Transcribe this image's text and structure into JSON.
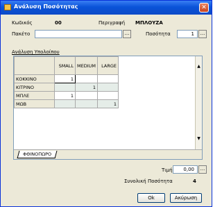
{
  "window": {
    "title": "Ανάλυση Ποσότητας",
    "close_glyph": "✕"
  },
  "form": {
    "code_label": "Κωδικός",
    "code_value": "00",
    "desc_label": "Περιγραφή",
    "desc_value": "ΜΠΛΟΥΖΑ",
    "package_label": "Πακέτο",
    "package_value": "",
    "quantity_label": "Ποσότητα",
    "quantity_value": "1",
    "ellipsis": "..."
  },
  "group": {
    "label": "Ανάλυση Υπολοίπου"
  },
  "grid": {
    "columns": [
      "SMALL",
      "MEDIUM",
      "LARGE"
    ],
    "rows": [
      {
        "label": "ΚΟΚΚΙΝΟ",
        "cells": [
          "1",
          "",
          ""
        ]
      },
      {
        "label": "ΚΙΤΡΙΝΟ",
        "cells": [
          "",
          "1",
          ""
        ]
      },
      {
        "label": "ΜΠΛΕ",
        "cells": [
          "1",
          "",
          ""
        ]
      },
      {
        "label": "ΜΩΒ",
        "cells": [
          "",
          "",
          "1"
        ]
      }
    ],
    "sheet_tab": "ΦΘΙΝΟΠΩΡΟ"
  },
  "totals": {
    "price_label": "Τιμή",
    "price_value": "0,00",
    "total_label": "Συνολική Ποσότητα",
    "total_value": "4"
  },
  "buttons": {
    "ok": "Ok",
    "cancel": "Ακύρωση"
  },
  "colors": {
    "titlebar": "#0a53d8",
    "window_bg": "#ece9d8",
    "alt_row": "#e5ede8"
  }
}
